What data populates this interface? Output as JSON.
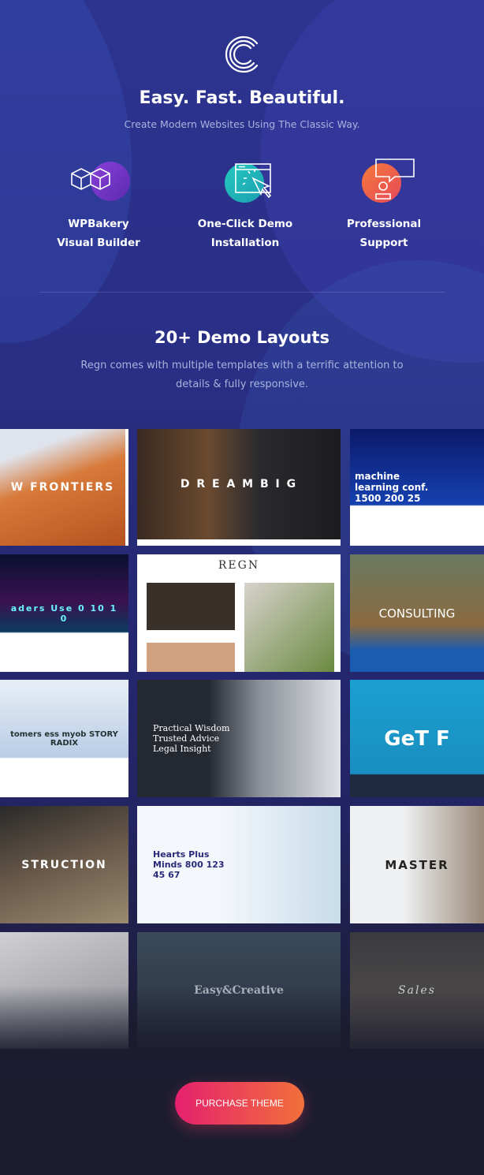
{
  "hero": {
    "title": "Easy. Fast. Beautiful.",
    "subtitle": "Create Modern Websites Using The Classic Way."
  },
  "features": [
    {
      "icon": "cubes-icon",
      "line1": "WPBakery",
      "line2": "Visual Builder",
      "color": "#7b3fd0"
    },
    {
      "icon": "browser-click-icon",
      "line1": "One-Click Demo",
      "line2": "Installation",
      "color": "#1fc0b5"
    },
    {
      "icon": "chat-support-icon",
      "line1": "Professional",
      "line2": "Support",
      "color": "#f0604a"
    }
  ],
  "demos": {
    "title": "20+ Demo Layouts",
    "description": "Regn comes with multiple templates with a terrific attention to details & fully responsive.",
    "thumbnails": [
      {
        "text": "W FRONTIERS"
      },
      {
        "text": "D R E A M   B I G"
      },
      {
        "text": "machine learning conf. 1500 200 25"
      },
      {
        "text": "aders Use 0 10 1 0"
      },
      {
        "text": "REGN"
      },
      {
        "text": "CONSULTING"
      },
      {
        "text": "tomers ess myob STORY RADIX"
      },
      {
        "text": "Practical Wisdom Trusted Advice Legal Insight"
      },
      {
        "text": "GeT F"
      },
      {
        "text": "STRUCTION"
      },
      {
        "text": "Hearts Plus Minds 800 123 45 67"
      },
      {
        "text": "MASTER"
      },
      {
        "text": ""
      },
      {
        "text": "Easy&Creative"
      },
      {
        "text": "Sales"
      }
    ]
  },
  "cta": {
    "label": "PURCHASE THEME"
  }
}
